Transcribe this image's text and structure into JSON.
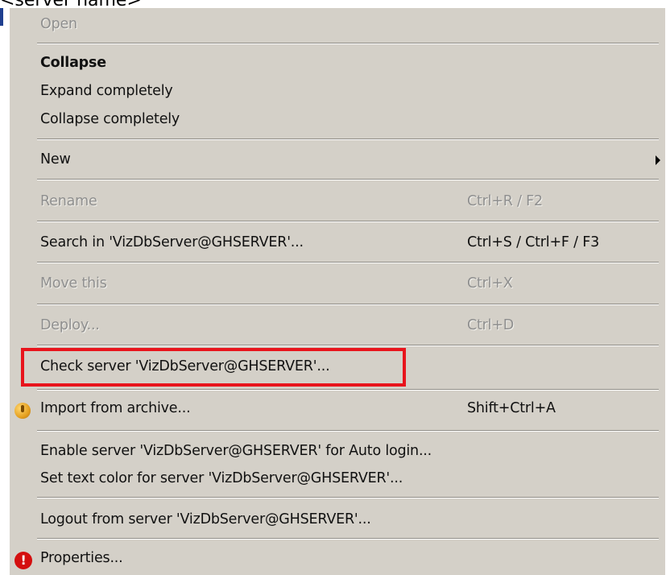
{
  "caption": "<server name>",
  "menu": {
    "open": {
      "label": "Open"
    },
    "collapse": {
      "label": "Collapse"
    },
    "expand_completely": {
      "label": "Expand completely"
    },
    "collapse_completely": {
      "label": "Collapse completely"
    },
    "new": {
      "label": "New"
    },
    "rename": {
      "label": "Rename",
      "shortcut": "Ctrl+R / F2"
    },
    "search": {
      "label": "Search in 'VizDbServer@GHSERVER'...",
      "shortcut": "Ctrl+S / Ctrl+F / F3"
    },
    "move_this": {
      "label": "Move this",
      "shortcut": "Ctrl+X"
    },
    "deploy": {
      "label": "Deploy...",
      "shortcut": "Ctrl+D"
    },
    "check_server": {
      "label": "Check server 'VizDbServer@GHSERVER'..."
    },
    "import_archive": {
      "label": "Import from archive...",
      "shortcut": "Shift+Ctrl+A"
    },
    "enable_autologin": {
      "label": "Enable server 'VizDbServer@GHSERVER' for Auto login..."
    },
    "set_text_color": {
      "label": "Set text color for server 'VizDbServer@GHSERVER'..."
    },
    "logout": {
      "label": "Logout from server 'VizDbServer@GHSERVER'..."
    },
    "properties": {
      "label": "Properties..."
    }
  },
  "icons": {
    "import_archive": "archive-import-icon",
    "properties": "properties-alert-icon",
    "submenu": "submenu-arrow-icon"
  },
  "colors": {
    "menu_background": "#d4d0c8",
    "disabled_text": "#8f8f8f",
    "highlight_border": "#e8141c"
  }
}
